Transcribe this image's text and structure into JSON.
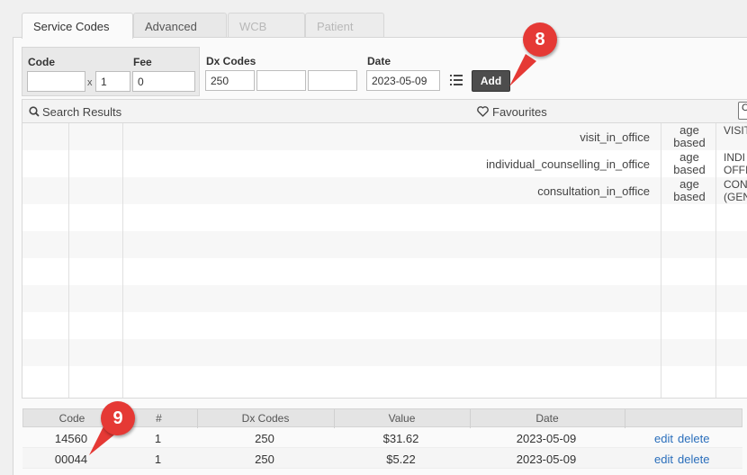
{
  "tabs": [
    {
      "label": "Service Codes",
      "state": "active"
    },
    {
      "label": "Advanced",
      "state": "normal"
    },
    {
      "label": "WCB",
      "state": "disabled"
    },
    {
      "label": "Patient",
      "state": "disabled"
    }
  ],
  "form": {
    "code_label": "Code",
    "code_value": "",
    "multiplier_sep": "x",
    "units_value": "1",
    "fee_label": "Fee",
    "fee_value": "0",
    "dx_label": "Dx Codes",
    "dx1_value": "250",
    "dx2_value": "",
    "dx3_value": "",
    "date_label": "Date",
    "date_value": "2023-05-09",
    "list_icon": "list-icon",
    "add_label": "Add"
  },
  "search_results": {
    "title": "Search Results",
    "icon": "search-icon"
  },
  "favourites": {
    "title": "Favourites",
    "icon": "heart-icon",
    "rows": [
      {
        "name": "visit_in_office",
        "age": "age based",
        "desc": "VISIT"
      },
      {
        "name": "individual_counselling_in_office",
        "age": "age based",
        "desc": "INDI\nOFFI"
      },
      {
        "name": "consultation_in_office",
        "age": "age based",
        "desc": "CON\n(GEN"
      }
    ]
  },
  "billing_table": {
    "headers": [
      "Code",
      "#",
      "Dx Codes",
      "Value",
      "Date",
      ""
    ],
    "rows": [
      {
        "code": "14560",
        "count": "1",
        "dx": "250",
        "value": "$31.62",
        "date": "2023-05-09",
        "edit": "edit",
        "delete": "delete"
      },
      {
        "code": "00044",
        "count": "1",
        "dx": "250",
        "value": "$5.22",
        "date": "2023-05-09",
        "edit": "edit",
        "delete": "delete"
      }
    ]
  },
  "callouts": [
    "8",
    "9"
  ],
  "colors": {
    "callout": "#e53935",
    "link": "#2a6ebb",
    "add_button": "#4d4d4d"
  }
}
